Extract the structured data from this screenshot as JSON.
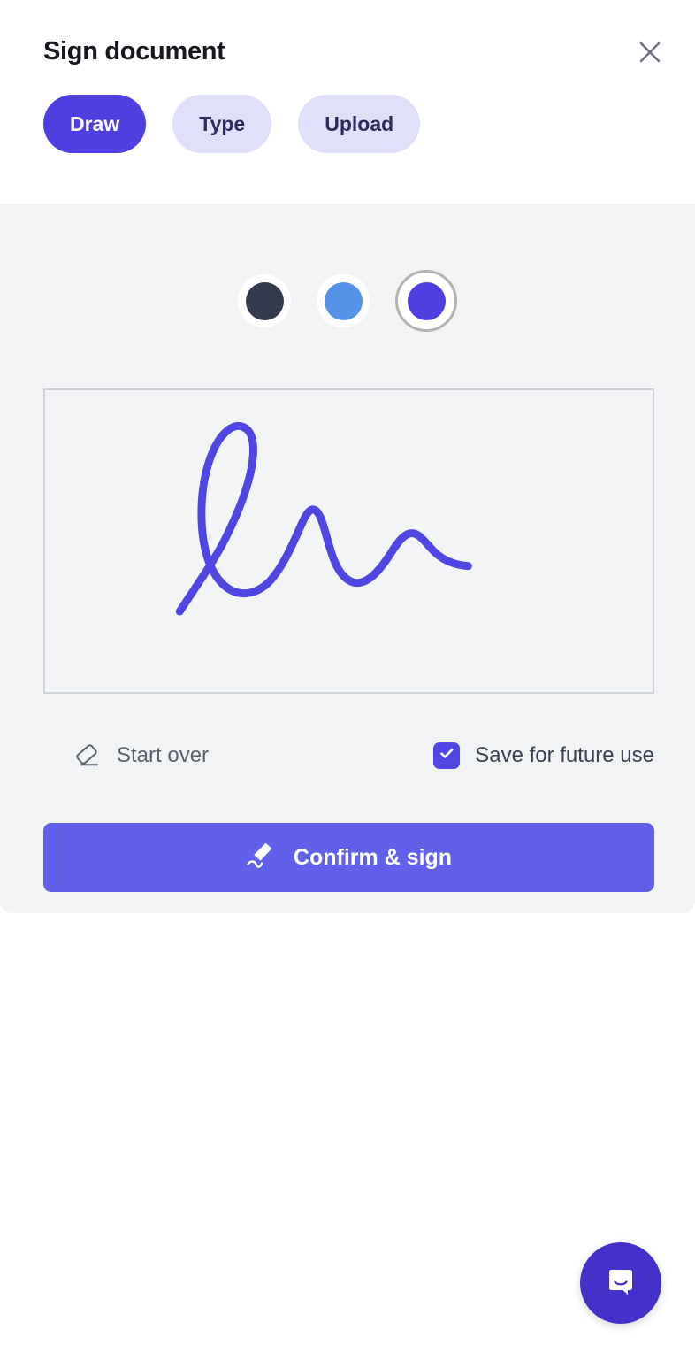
{
  "header": {
    "title": "Sign document",
    "close_icon": "close-icon"
  },
  "tabs": [
    {
      "label": "Draw",
      "active": true
    },
    {
      "label": "Type",
      "active": false
    },
    {
      "label": "Upload",
      "active": false
    }
  ],
  "colors": {
    "accent": "#4f3ee0",
    "button": "#6060e8",
    "tab_inactive_bg": "#e0e0fa",
    "tab_inactive_text": "#2b2b60",
    "panel_bg": "#f1f3f5",
    "canvas_border": "#ced1da",
    "title_text": "#17181f",
    "muted_text": "#5b616e",
    "selection_ring": "#b3b3b3"
  },
  "swatches": [
    {
      "name": "color-swatch-dark",
      "color": "#343b4c",
      "selected": false
    },
    {
      "name": "color-swatch-blue",
      "color": "#5592e8",
      "selected": false
    },
    {
      "name": "color-swatch-purple",
      "color": "#4f3ee0",
      "selected": true
    }
  ],
  "canvas": {
    "stroke_color": "#5046e4",
    "stroke_width": 9,
    "has_signature": true
  },
  "controls": {
    "start_over_label": "Start over",
    "start_over_icon": "eraser-icon",
    "save_future_label": "Save for future use",
    "save_future_checked": true
  },
  "confirm": {
    "label": "Confirm & sign",
    "icon": "signature-pen-icon"
  },
  "chat": {
    "icon": "chat-bubble-icon"
  }
}
